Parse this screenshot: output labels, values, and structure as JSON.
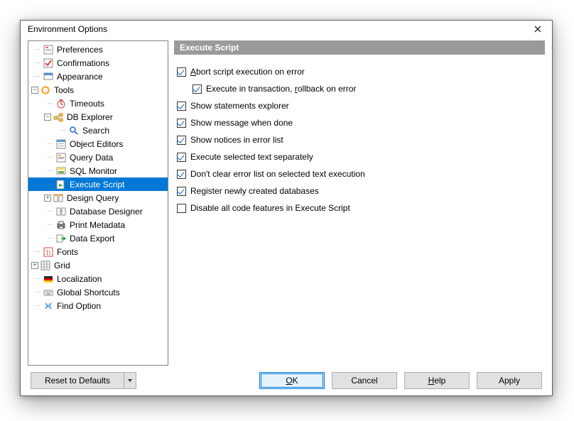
{
  "window": {
    "title": "Environment Options"
  },
  "tree": {
    "preferences": "Preferences",
    "confirmations": "Confirmations",
    "appearance": "Appearance",
    "tools": "Tools",
    "timeouts": "Timeouts",
    "db_explorer": "DB Explorer",
    "search": "Search",
    "object_editors": "Object Editors",
    "query_data": "Query Data",
    "sql_monitor": "SQL Monitor",
    "execute_script": "Execute Script",
    "design_query": "Design Query",
    "database_designer": "Database Designer",
    "print_metadata": "Print Metadata",
    "data_export": "Data Export",
    "fonts": "Fonts",
    "grid": "Grid",
    "localization": "Localization",
    "global_shortcuts": "Global Shortcuts",
    "find_option": "Find Option"
  },
  "section": {
    "header": "Execute Script"
  },
  "checks": {
    "abort": "Abort script execution on error",
    "exec_tx": "Execute in transaction, rollback on error",
    "show_stmt": "Show statements explorer",
    "show_msg": "Show message when done",
    "show_notices": "Show notices in error list",
    "exec_sel": "Execute selected text separately",
    "dont_clear": "Don't clear error list on selected text execution",
    "register_db": "Register newly created databases",
    "disable_code": "Disable all code features in Execute Script"
  },
  "buttons": {
    "reset": "Reset to Defaults",
    "ok": "OK",
    "cancel": "Cancel",
    "help": "Help",
    "apply": "Apply"
  }
}
